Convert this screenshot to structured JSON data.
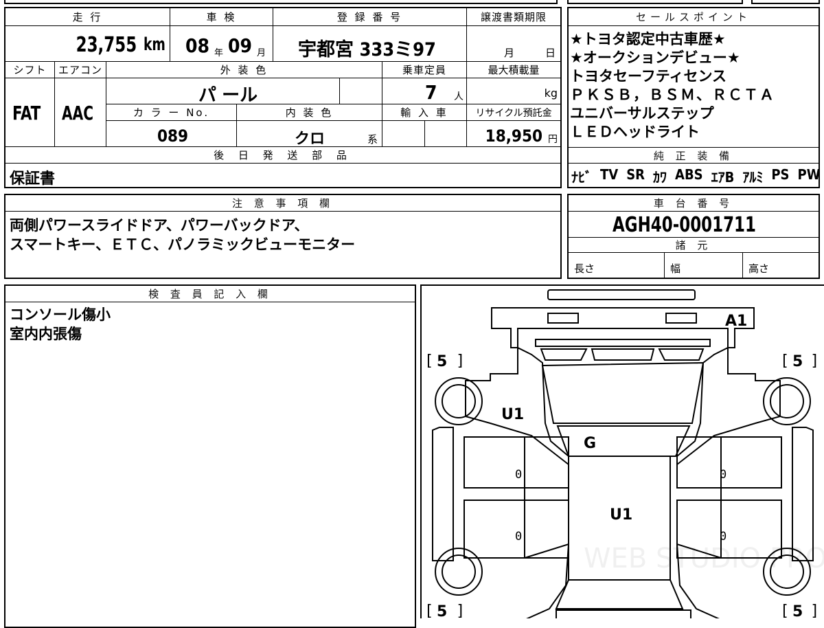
{
  "top_table": {
    "mileage_header": "走 行",
    "mileage_value": "23,755",
    "mileage_unit": "km",
    "inspection_header": "車 検",
    "inspection_year": "08",
    "inspection_year_unit": "年",
    "inspection_month": "09",
    "inspection_month_unit": "月",
    "registration_header": "登 録 番 号",
    "registration_value": "宇都宮 333ミ97",
    "transfer_header": "譲渡書類期限",
    "transfer_month_unit": "月",
    "transfer_day_unit": "日",
    "shift_header": "シフト",
    "shift_value": "FAT",
    "aircon_header": "エアコン",
    "aircon_value": "AAC",
    "exterior_color_header": "外 装 色",
    "exterior_color_value": "パ ール",
    "capacity_header": "乗車定員",
    "capacity_value": "7",
    "capacity_unit": "人",
    "max_load_header": "最大積載量",
    "max_load_unit": "kg",
    "color_no_header": "カ ラ ー No.",
    "color_no_value": "089",
    "interior_color_header": "内 装 色",
    "interior_color_value": "クロ",
    "interior_color_suffix": "系",
    "import_header": "輸 入 車",
    "recycle_header": "リサイクル預託金",
    "recycle_value": "18,950",
    "recycle_unit": "円",
    "later_parts_header": "後 日 発 送 部 品",
    "later_parts_value": "保証書"
  },
  "sales_points": {
    "header": "セールスポイント",
    "lines": [
      "★トヨタ認定中古車歴★",
      "★オークションデビュー★",
      "トヨタセーフティセンス",
      "ＰＫＳＢ，ＢＳＭ、ＲＣＴＡ",
      "ユニバーサルステップ",
      "ＬＥＤヘッドライト"
    ]
  },
  "genuine_equipment": {
    "header": "純 正 装 備",
    "items": [
      "ﾅﾋﾞ",
      "TV",
      "SR",
      "ｶﾜ",
      "ABS",
      "ｴｱB",
      "ｱﾙﾐ",
      "PS",
      "PW"
    ]
  },
  "notes": {
    "header": "注 意 事 項 欄",
    "lines": [
      "両側パワースライドドア、パワーバックドア、",
      "スマートキー、ＥＴＣ、パノラミックビューモニター"
    ]
  },
  "chassis": {
    "header": "車 台 番 号",
    "value": "AGH40-0001711"
  },
  "specs": {
    "header": "諸 元",
    "length_label": "長さ",
    "width_label": "幅",
    "height_label": "高さ"
  },
  "inspector": {
    "header": "検 査 員 記 入 欄",
    "lines": [
      "コンソール傷小",
      "室内内張傷"
    ]
  },
  "diagram": {
    "marks": {
      "rear": "A1",
      "tire_fl": "5",
      "tire_fr": "5",
      "tire_rl": "5",
      "tire_rr": "5",
      "hood_side": "U1",
      "windshield": "G",
      "roof": "U1",
      "door_left_front": "0",
      "door_left_rear": "0",
      "door_right_front": "0",
      "door_right_rear": "0"
    },
    "watermark": "WEB STUDIO PRO"
  }
}
